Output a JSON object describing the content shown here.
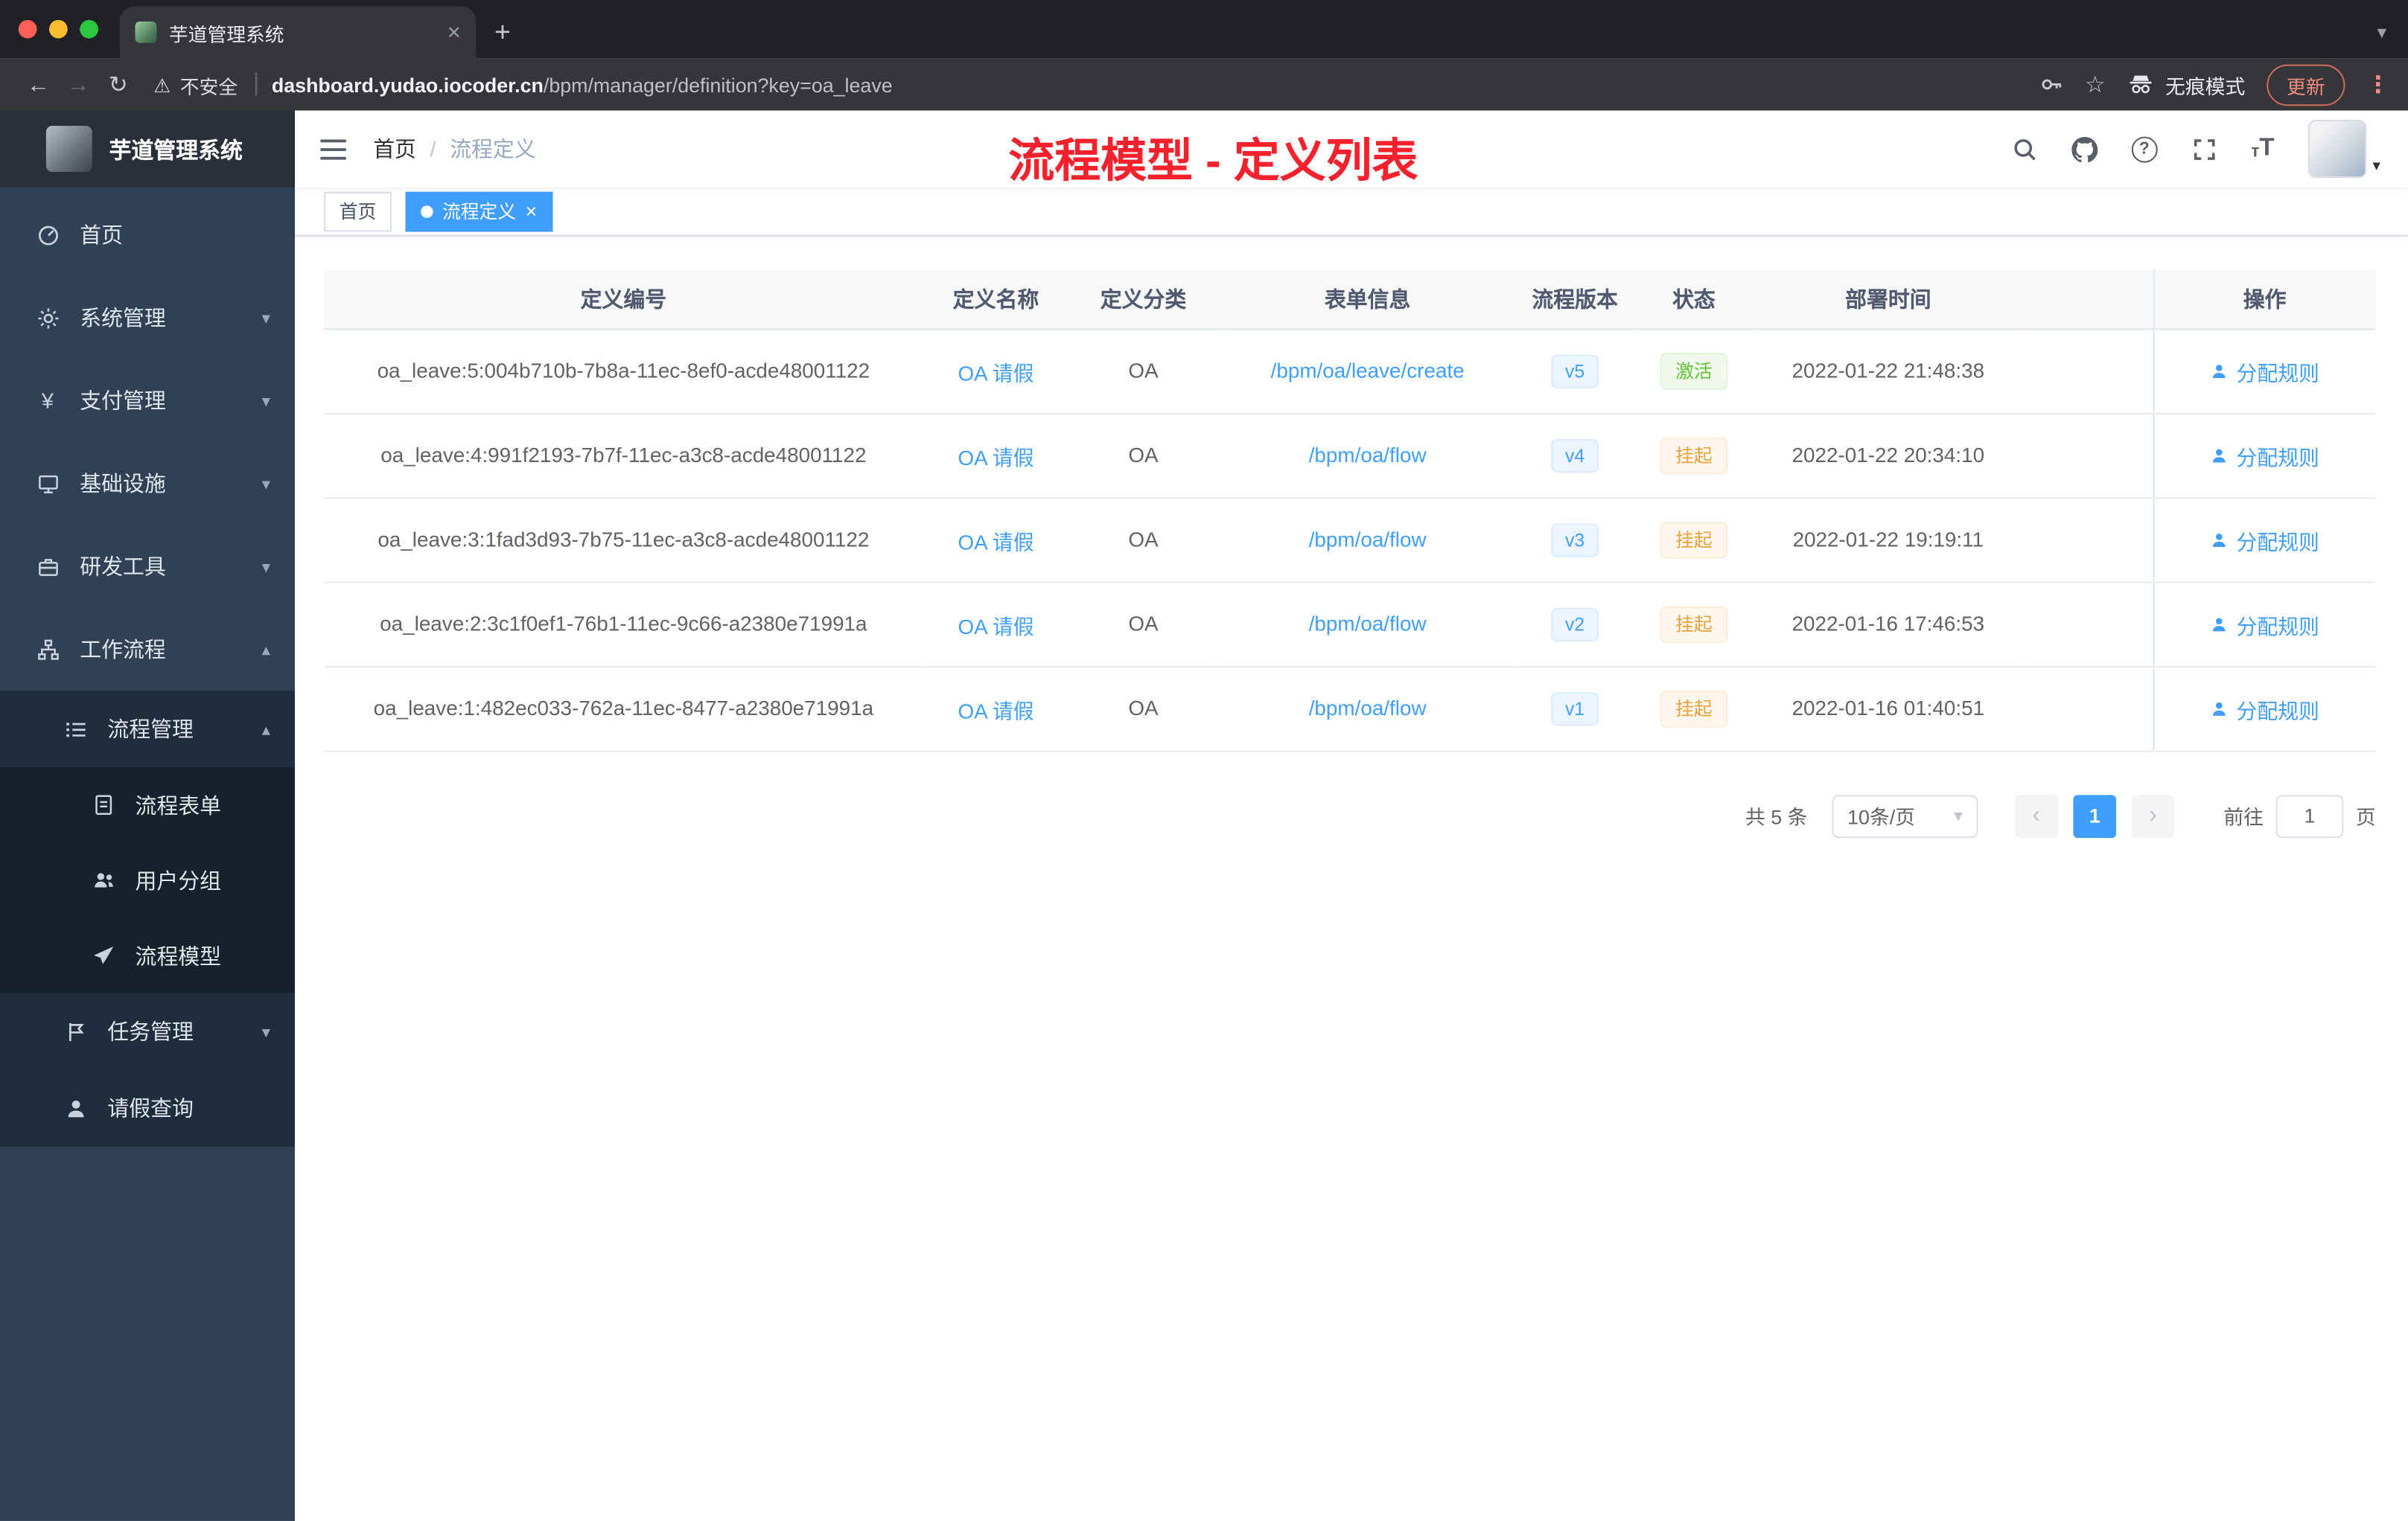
{
  "browser": {
    "tab_title": "芋道管理系统",
    "security_label": "不安全",
    "url_domain": "dashboard.yudao.iocoder.cn",
    "url_path": "/bpm/manager/definition?key=oa_leave",
    "incognito_label": "无痕模式",
    "update_label": "更新"
  },
  "icons": {
    "back": "←",
    "forward": "→",
    "reload": "↻",
    "warning": "⚠",
    "divider": "|",
    "close": "×",
    "new_tab": "+",
    "tab_menu": "▾",
    "star": "☆",
    "menu_dots": "⋮",
    "question": "?",
    "font_size_small": "т",
    "font_size_big": "T",
    "chevron_down": "▾",
    "chevron_up": "▴",
    "caret_down": "▾",
    "yen": "¥",
    "prev": "‹",
    "next": "›",
    "breadcrumb_sep": "/"
  },
  "sidebar": {
    "logo_title": "芋道管理系统",
    "items": {
      "home": "首页",
      "system": "系统管理",
      "payment": "支付管理",
      "infra": "基础设施",
      "devtools": "研发工具",
      "workflow": "工作流程",
      "process_mgmt": "流程管理",
      "process_form": "流程表单",
      "user_group": "用户分组",
      "process_model": "流程模型",
      "task_mgmt": "任务管理",
      "leave_query": "请假查询"
    }
  },
  "header": {
    "breadcrumb_home": "首页",
    "breadcrumb_current": "流程定义",
    "annotation": "流程模型 - 定义列表"
  },
  "tags": {
    "home": "首页",
    "current": "流程定义"
  },
  "table": {
    "columns": [
      "定义编号",
      "定义名称",
      "定义分类",
      "表单信息",
      "流程版本",
      "状态",
      "部署时间",
      "操作"
    ],
    "rows": [
      {
        "id": "oa_leave:5:004b710b-7b8a-11ec-8ef0-acde48001122",
        "name": "OA 请假",
        "category": "OA",
        "form": "/bpm/oa/leave/create",
        "version": "v5",
        "status": "激活",
        "status_type": "success",
        "time": "2022-01-22 21:48:38",
        "action": "分配规则"
      },
      {
        "id": "oa_leave:4:991f2193-7b7f-11ec-a3c8-acde48001122",
        "name": "OA 请假",
        "category": "OA",
        "form": "/bpm/oa/flow",
        "version": "v4",
        "status": "挂起",
        "status_type": "warning",
        "time": "2022-01-22 20:34:10",
        "action": "分配规则"
      },
      {
        "id": "oa_leave:3:1fad3d93-7b75-11ec-a3c8-acde48001122",
        "name": "OA 请假",
        "category": "OA",
        "form": "/bpm/oa/flow",
        "version": "v3",
        "status": "挂起",
        "status_type": "warning",
        "time": "2022-01-22 19:19:11",
        "action": "分配规则"
      },
      {
        "id": "oa_leave:2:3c1f0ef1-76b1-11ec-9c66-a2380e71991a",
        "name": "OA 请假",
        "category": "OA",
        "form": "/bpm/oa/flow",
        "version": "v2",
        "status": "挂起",
        "status_type": "warning",
        "time": "2022-01-16 17:46:53",
        "action": "分配规则"
      },
      {
        "id": "oa_leave:1:482ec033-762a-11ec-8477-a2380e71991a",
        "name": "OA 请假",
        "category": "OA",
        "form": "/bpm/oa/flow",
        "version": "v1",
        "status": "挂起",
        "status_type": "warning",
        "time": "2022-01-16 01:40:51",
        "action": "分配规则"
      }
    ]
  },
  "pagination": {
    "total": "共 5 条",
    "page_size": "10条/页",
    "current_page": "1",
    "goto_label": "前往",
    "goto_value": "1",
    "goto_suffix": "页"
  },
  "colors": {
    "accent": "#409eff",
    "success": "#67c23a",
    "warning": "#e6a23c",
    "annotation_red": "#f5222d",
    "sidebar_bg": "#304156"
  }
}
